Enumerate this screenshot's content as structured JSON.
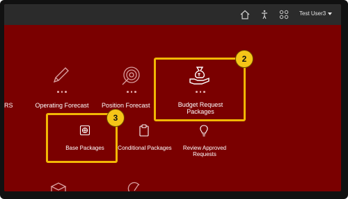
{
  "topbar": {
    "user_label": "Test User3",
    "icons": [
      "home-icon",
      "accessibility-icon",
      "apps-grid-icon"
    ]
  },
  "tiles": {
    "partial_left_label": "RS",
    "operating_forecast": "Operating Forecast",
    "position_forecast": "Position Forecast",
    "budget_request_packages_line1": "Budget Request",
    "budget_request_packages_line2": "Packages",
    "base_packages": "Base Packages",
    "conditional_packages": "Conditional Packages",
    "review_approved_line1": "Review Approved",
    "review_approved_line2": "Requests"
  },
  "callouts": {
    "step_budget": "2",
    "step_base": "3"
  },
  "colors": {
    "background": "#7a0000",
    "topbar": "#2b2b2b",
    "highlight": "#f2b705"
  }
}
